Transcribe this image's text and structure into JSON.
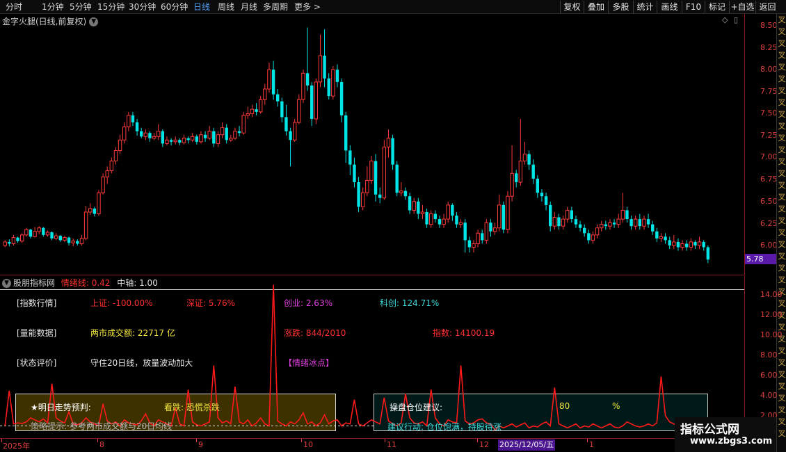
{
  "toolbar": {
    "periods": [
      "分时",
      "1分钟",
      "5分钟",
      "15分钟",
      "30分钟",
      "60分钟",
      "日线",
      "周线",
      "月线",
      "多周期",
      "更多 >"
    ],
    "active_period": "日线",
    "right_buttons": [
      "复权",
      "叠加",
      "多股",
      "统计",
      "画线",
      "F10",
      "标记",
      "+自选",
      "返回"
    ]
  },
  "main_chart": {
    "title": "金字火腿(日线,前复权)",
    "icons": [
      "◇",
      "▯"
    ],
    "price_ticks": [
      "8.50",
      "8.25",
      "8.00",
      "7.75",
      "7.50",
      "7.25",
      "7.00",
      "6.75",
      "6.50",
      "6.25",
      "6.00"
    ],
    "current_price": "5.78"
  },
  "side_strip_text": "叉叉叉叉叉叉叉叉叉叉叉叉叉叉叉叉叉叉叉叉叉叉叉叉叉叉叉叉叉叉叉叉叉叉叉叉",
  "indicator": {
    "title": "股朋指标网",
    "emotion_label": "情绪线: 0.42",
    "axis_label": "中轴: 1.00",
    "ticks": [
      "14.00",
      "12.00",
      "10.00",
      "8.00",
      "6.00",
      "4.00",
      "2.00"
    ]
  },
  "info": {
    "index_header": "[指数行情]",
    "sh": "上证: -100.00%",
    "sz": "深证: 5.76%",
    "cy": "创业: 2.63%",
    "kc": "科创: 124.71%",
    "volume_header": "[量能数据]",
    "turnover": "两市成交额: 22717 亿",
    "updown": "涨跌: 844/2010",
    "index_val": "指数: 14100.19",
    "state_header": "[状态评价]",
    "state_text": "守住20日线，放量波动加大",
    "mood": "【情绪冰点】"
  },
  "prediction": {
    "title": "★明日走势预判:",
    "value": "看跌: 恐慌杀跌",
    "tip": "策略提示: 参考两市成交额与20日均线"
  },
  "position": {
    "title": "操盘仓位建议:",
    "value": "80",
    "unit": "%",
    "action": "建议行动: 仓位饱满，持股待涨"
  },
  "date_axis": {
    "labels": [
      "2025年",
      "8",
      "9",
      "10",
      "11",
      "12",
      "1"
    ],
    "cursor": "2025/12/05/五"
  },
  "watermark": {
    "title": "指标公式网",
    "url": "www.zbgs3.com"
  },
  "colors": {
    "up": "#ff3b3b",
    "down": "#00e5e5",
    "emotion_line": "#ff1a1a",
    "axis": "#e04040"
  },
  "chart_data": {
    "type": "candlestick",
    "ylim": [
      5.78,
      8.5
    ],
    "candles": [
      [
        6.0,
        6.04,
        5.98,
        6.06
      ],
      [
        6.04,
        6.02,
        5.99,
        6.07
      ],
      [
        6.02,
        6.09,
        6.0,
        6.12
      ],
      [
        6.09,
        6.05,
        6.03,
        6.1
      ],
      [
        6.05,
        6.12,
        6.03,
        6.14
      ],
      [
        6.12,
        6.18,
        6.1,
        6.2
      ],
      [
        6.18,
        6.1,
        6.08,
        6.19
      ],
      [
        6.1,
        6.16,
        6.09,
        6.21
      ],
      [
        6.16,
        6.2,
        6.13,
        6.22
      ],
      [
        6.2,
        6.12,
        6.1,
        6.21
      ],
      [
        6.12,
        6.15,
        6.1,
        6.17
      ],
      [
        6.15,
        6.08,
        6.06,
        6.16
      ],
      [
        6.08,
        6.11,
        6.06,
        6.14
      ],
      [
        6.11,
        6.06,
        6.04,
        6.12
      ],
      [
        6.06,
        6.09,
        6.04,
        6.11
      ],
      [
        6.09,
        6.03,
        6.0,
        6.1
      ],
      [
        6.03,
        6.05,
        5.99,
        6.08
      ],
      [
        6.05,
        6.02,
        6.0,
        6.07
      ],
      [
        6.02,
        6.08,
        6.0,
        6.12
      ],
      [
        6.08,
        6.38,
        6.06,
        6.45
      ],
      [
        6.38,
        6.42,
        6.35,
        6.48
      ],
      [
        6.42,
        6.36,
        6.33,
        6.44
      ],
      [
        6.36,
        6.6,
        6.34,
        6.63
      ],
      [
        6.6,
        6.78,
        6.58,
        6.82
      ],
      [
        6.78,
        6.85,
        6.7,
        6.9
      ],
      [
        6.85,
        6.96,
        6.82,
        7.0
      ],
      [
        6.96,
        7.08,
        6.92,
        7.12
      ],
      [
        7.08,
        7.2,
        7.04,
        7.26
      ],
      [
        7.2,
        7.35,
        7.16,
        7.4
      ],
      [
        7.35,
        7.48,
        7.3,
        7.52
      ],
      [
        7.48,
        7.4,
        7.36,
        7.52
      ],
      [
        7.4,
        7.3,
        7.25,
        7.44
      ],
      [
        7.3,
        7.24,
        7.22,
        7.34
      ],
      [
        7.24,
        7.28,
        7.2,
        7.32
      ],
      [
        7.28,
        7.22,
        7.18,
        7.3
      ],
      [
        7.22,
        7.24,
        7.2,
        7.28
      ],
      [
        7.24,
        7.3,
        7.2,
        7.38
      ],
      [
        7.3,
        7.16,
        7.12,
        7.32
      ],
      [
        7.16,
        7.2,
        7.14,
        7.24
      ],
      [
        7.2,
        7.18,
        7.14,
        7.22
      ],
      [
        7.18,
        7.2,
        7.15,
        7.24
      ],
      [
        7.2,
        7.17,
        7.14,
        7.22
      ],
      [
        7.17,
        7.22,
        7.15,
        7.26
      ],
      [
        7.22,
        7.2,
        7.16,
        7.24
      ],
      [
        7.2,
        7.24,
        7.18,
        7.28
      ],
      [
        7.24,
        7.18,
        7.15,
        7.26
      ],
      [
        7.18,
        7.26,
        7.16,
        7.3
      ],
      [
        7.26,
        7.22,
        7.18,
        7.3
      ],
      [
        7.22,
        7.3,
        7.2,
        7.36
      ],
      [
        7.3,
        7.16,
        7.12,
        7.34
      ],
      [
        7.16,
        7.26,
        7.12,
        7.3
      ],
      [
        7.26,
        7.34,
        7.22,
        7.4
      ],
      [
        7.34,
        7.2,
        7.16,
        7.38
      ],
      [
        7.2,
        7.22,
        7.18,
        7.26
      ],
      [
        7.22,
        7.3,
        7.2,
        7.34
      ],
      [
        7.3,
        7.28,
        7.24,
        7.36
      ],
      [
        7.28,
        7.48,
        7.26,
        7.52
      ],
      [
        7.48,
        7.5,
        7.44,
        7.58
      ],
      [
        7.5,
        7.55,
        7.46,
        7.6
      ],
      [
        7.55,
        7.52,
        7.48,
        7.62
      ],
      [
        7.52,
        7.66,
        7.5,
        7.7
      ],
      [
        7.66,
        7.78,
        7.6,
        7.84
      ],
      [
        7.78,
        8.0,
        7.74,
        8.08
      ],
      [
        8.0,
        7.72,
        7.66,
        8.1
      ],
      [
        7.72,
        7.64,
        7.58,
        7.78
      ],
      [
        7.64,
        7.46,
        7.4,
        7.68
      ],
      [
        7.46,
        7.3,
        7.25,
        7.6
      ],
      [
        7.3,
        7.2,
        6.9,
        7.34
      ],
      [
        7.2,
        7.4,
        7.18,
        7.44
      ],
      [
        7.4,
        7.66,
        7.38,
        7.72
      ],
      [
        7.66,
        7.96,
        7.62,
        8.0
      ],
      [
        7.96,
        7.82,
        7.76,
        8.48
      ],
      [
        7.82,
        7.44,
        7.36,
        7.86
      ],
      [
        7.44,
        7.86,
        7.38,
        7.9
      ],
      [
        7.86,
        8.16,
        7.8,
        8.4
      ],
      [
        8.16,
        7.9,
        7.8,
        8.46
      ],
      [
        7.9,
        7.7,
        7.66,
        7.96
      ],
      [
        7.7,
        8.0,
        7.66,
        8.04
      ],
      [
        8.0,
        7.86,
        7.8,
        8.06
      ],
      [
        7.86,
        7.48,
        7.4,
        7.9
      ],
      [
        7.48,
        7.08,
        6.94,
        7.52
      ],
      [
        7.08,
        6.92,
        6.8,
        7.14
      ],
      [
        6.92,
        6.72,
        6.66,
        7.0
      ],
      [
        6.72,
        6.44,
        6.38,
        6.78
      ],
      [
        6.44,
        6.6,
        6.4,
        6.66
      ],
      [
        6.6,
        6.74,
        6.56,
        6.9
      ],
      [
        6.74,
        6.96,
        6.7,
        7.02
      ],
      [
        6.96,
        6.58,
        6.5,
        7.04
      ],
      [
        6.58,
        6.54,
        6.48,
        6.66
      ],
      [
        6.54,
        7.12,
        6.52,
        7.2
      ],
      [
        7.12,
        7.22,
        7.0,
        7.32
      ],
      [
        7.22,
        6.92,
        6.86,
        7.26
      ],
      [
        6.92,
        6.6,
        6.56,
        6.96
      ],
      [
        6.6,
        6.62,
        6.56,
        6.72
      ],
      [
        6.62,
        6.56,
        6.52,
        6.66
      ],
      [
        6.56,
        6.4,
        6.36,
        6.6
      ],
      [
        6.4,
        6.5,
        6.36,
        6.54
      ],
      [
        6.5,
        6.36,
        6.3,
        6.54
      ],
      [
        6.36,
        6.38,
        6.3,
        6.46
      ],
      [
        6.38,
        6.24,
        6.2,
        6.42
      ],
      [
        6.24,
        6.36,
        6.2,
        6.4
      ],
      [
        6.36,
        6.3,
        6.26,
        6.4
      ],
      [
        6.3,
        6.24,
        6.2,
        6.34
      ],
      [
        6.24,
        6.3,
        6.2,
        6.36
      ],
      [
        6.3,
        6.46,
        6.26,
        6.5
      ],
      [
        6.46,
        6.34,
        6.28,
        6.48
      ],
      [
        6.34,
        6.24,
        6.2,
        6.38
      ],
      [
        6.24,
        6.26,
        6.2,
        6.3
      ],
      [
        6.26,
        6.06,
        5.92,
        6.3
      ],
      [
        6.06,
        5.98,
        5.92,
        6.1
      ],
      [
        5.98,
        6.02,
        5.92,
        6.06
      ],
      [
        6.02,
        6.14,
        5.98,
        6.18
      ],
      [
        6.14,
        6.06,
        6.02,
        6.18
      ],
      [
        6.06,
        6.26,
        6.02,
        6.3
      ],
      [
        6.26,
        6.16,
        6.1,
        6.3
      ],
      [
        6.16,
        6.2,
        6.12,
        6.26
      ],
      [
        6.2,
        6.46,
        6.16,
        6.58
      ],
      [
        6.46,
        6.18,
        6.14,
        6.5
      ],
      [
        6.18,
        6.56,
        6.14,
        6.62
      ],
      [
        6.56,
        6.82,
        6.5,
        7.14
      ],
      [
        6.82,
        6.72,
        6.66,
        6.86
      ],
      [
        6.72,
        6.96,
        6.68,
        7.44
      ],
      [
        6.96,
        7.04,
        6.92,
        7.18
      ],
      [
        7.04,
        6.92,
        6.86,
        7.08
      ],
      [
        6.92,
        6.76,
        6.7,
        6.98
      ],
      [
        6.76,
        6.6,
        6.54,
        6.8
      ],
      [
        6.6,
        6.56,
        6.5,
        6.64
      ],
      [
        6.56,
        6.46,
        6.4,
        6.6
      ],
      [
        6.46,
        6.22,
        6.16,
        6.5
      ],
      [
        6.22,
        6.32,
        6.18,
        6.38
      ],
      [
        6.32,
        6.22,
        6.18,
        6.36
      ],
      [
        6.22,
        6.3,
        6.18,
        6.34
      ],
      [
        6.3,
        6.4,
        6.26,
        6.44
      ],
      [
        6.4,
        6.3,
        6.26,
        6.44
      ],
      [
        6.3,
        6.24,
        6.2,
        6.34
      ],
      [
        6.24,
        6.2,
        6.16,
        6.28
      ],
      [
        6.2,
        6.14,
        6.1,
        6.24
      ],
      [
        6.14,
        6.06,
        6.02,
        6.18
      ],
      [
        6.06,
        6.12,
        6.02,
        6.16
      ],
      [
        6.12,
        6.2,
        6.08,
        6.24
      ],
      [
        6.2,
        6.24,
        6.16,
        6.28
      ],
      [
        6.24,
        6.22,
        6.18,
        6.28
      ],
      [
        6.22,
        6.26,
        6.18,
        6.3
      ],
      [
        6.26,
        6.24,
        6.2,
        6.3
      ],
      [
        6.24,
        6.3,
        6.2,
        6.36
      ],
      [
        6.3,
        6.4,
        6.26,
        6.6
      ],
      [
        6.4,
        6.3,
        6.26,
        6.44
      ],
      [
        6.3,
        6.22,
        6.18,
        6.34
      ],
      [
        6.22,
        6.3,
        6.18,
        6.34
      ],
      [
        6.3,
        6.22,
        6.18,
        6.36
      ],
      [
        6.22,
        6.3,
        6.18,
        6.34
      ],
      [
        6.3,
        6.24,
        6.2,
        6.36
      ],
      [
        6.24,
        6.16,
        6.12,
        6.28
      ],
      [
        6.16,
        6.08,
        6.04,
        6.2
      ],
      [
        6.08,
        6.1,
        6.04,
        6.14
      ],
      [
        6.1,
        6.06,
        6.02,
        6.14
      ],
      [
        6.06,
        6.0,
        5.96,
        6.1
      ],
      [
        6.0,
        6.04,
        5.96,
        6.12
      ],
      [
        6.04,
        5.98,
        5.94,
        6.08
      ],
      [
        5.98,
        6.02,
        5.94,
        6.06
      ],
      [
        6.02,
        5.98,
        5.94,
        6.06
      ],
      [
        5.98,
        6.04,
        5.94,
        6.08
      ],
      [
        6.04,
        6.0,
        5.96,
        6.06
      ],
      [
        6.0,
        6.04,
        5.96,
        6.1
      ],
      [
        6.04,
        5.98,
        5.94,
        6.06
      ],
      [
        5.98,
        5.84,
        5.8,
        6.0
      ]
    ],
    "emotion": [
      1.0,
      4.5,
      1.2,
      1.3,
      1.25,
      1.4,
      1.8,
      1.6,
      1.4,
      1.7,
      1.3,
      5.2,
      1.8,
      1.5,
      1.3,
      2.4,
      1.2,
      1.1,
      1.3,
      1.8,
      1.4,
      1.2,
      1.0,
      3.2,
      1.5,
      1.2,
      1.4,
      1.0,
      1.6,
      1.3,
      1.2,
      1.1,
      1.5,
      2.2,
      1.3,
      1.0,
      1.6,
      1.4,
      1.2,
      1.0,
      2.8,
      1.2,
      1.0,
      4.6,
      1.4,
      1.1,
      1.0,
      1.2,
      1.4,
      7.0,
      1.8,
      1.3,
      1.5,
      1.2,
      4.9,
      1.4,
      1.2,
      1.6,
      1.0,
      1.3,
      1.8,
      1.2,
      1.0,
      15.0,
      1.5,
      1.2,
      1.0,
      1.4,
      1.2,
      1.6,
      2.3,
      1.2,
      1.4,
      1.0,
      1.3,
      2.1,
      1.2,
      1.5,
      1.6,
      1.0,
      1.3,
      1.2,
      3.6,
      1.2,
      1.0,
      1.3,
      1.6,
      1.4,
      1.2,
      3.8,
      1.5,
      1.2,
      1.0,
      1.3,
      4.2,
      1.8,
      1.3,
      1.2,
      1.4,
      1.0,
      4.6,
      1.8,
      1.2,
      1.0,
      1.6,
      1.4,
      1.3,
      7.0,
      1.5,
      1.2,
      1.3,
      1.6,
      1.7,
      1.3,
      1.2,
      0.6,
      1.0,
      0.8,
      1.0,
      1.2,
      0.9,
      1.1,
      1.3,
      0.8,
      1.0,
      0.9,
      1.2,
      1.4,
      1.0,
      4.8,
      1.2,
      1.0,
      0.8,
      1.0,
      1.2,
      0.8,
      1.0,
      0.9,
      1.2,
      1.0,
      0.8,
      1.0,
      1.2,
      0.9,
      0.8,
      1.0,
      1.4,
      1.2,
      1.0,
      0.9,
      1.0,
      1.2,
      1.0,
      1.3,
      5.9,
      2.0,
      1.4,
      1.2,
      1.0,
      1.2,
      0.9,
      1.0,
      1.2,
      1.0,
      0.9,
      1.1,
      1.0,
      0.8,
      1.0,
      1.2,
      0.8,
      1.0,
      0.9,
      1.0
    ],
    "emotion_ylim": [
      0,
      15.5
    ],
    "neutral_axis": 1.0
  }
}
